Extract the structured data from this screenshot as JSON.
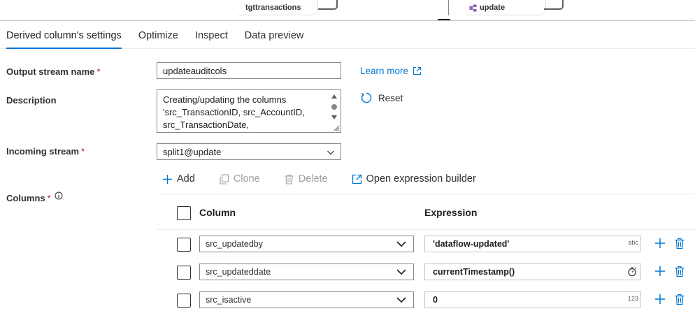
{
  "canvas": {
    "left_node_label": "tgttransactions",
    "right_node_label": "update",
    "split_icon": "split-icon"
  },
  "tabs": [
    {
      "label": "Derived column's settings",
      "active": true
    },
    {
      "label": "Optimize",
      "active": false
    },
    {
      "label": "Inspect",
      "active": false
    },
    {
      "label": "Data preview",
      "active": false
    }
  ],
  "form": {
    "output_stream_label": "Output stream name",
    "output_stream_value": "updateauditcols",
    "required_marker": "*",
    "description_label": "Description",
    "description_value": "Creating/updating the columns 'src_TransactionID, src_AccountID, src_TransactionDate,",
    "incoming_stream_label": "Incoming stream",
    "incoming_stream_value": "split1@update",
    "columns_label": "Columns",
    "learn_more": "Learn more",
    "reset": "Reset"
  },
  "toolbar": {
    "add": "Add",
    "clone": "Clone",
    "delete": "Delete",
    "open_expression_builder": "Open expression builder"
  },
  "grid": {
    "column_header": "Column",
    "expression_header": "Expression",
    "rows": [
      {
        "column": "src_updatedby",
        "expression": "'dataflow-updated'",
        "type_badge": "abc"
      },
      {
        "column": "src_updateddate",
        "expression": "currentTimestamp()",
        "type_badge": "timer-icon"
      },
      {
        "column": "src_isactive",
        "expression": "0",
        "type_badge": "123"
      }
    ]
  },
  "colors": {
    "accent": "#0078d4",
    "required": "#a4262c",
    "text": "#201f1e",
    "disabled": "#a19f9d"
  }
}
